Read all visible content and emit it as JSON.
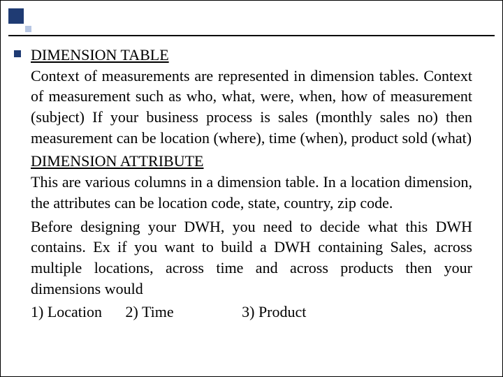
{
  "headings": {
    "dimension_table": "DIMENSION TABLE",
    "dimension_attribute": "DIMENSION ATTRIBUTE"
  },
  "paragraphs": {
    "p1": "Context of measurements are represented in dimension tables. Context of measurement such as who, what, were, when, how of measurement (subject) If your business process is sales (monthly sales no) then measurement can be location (where), time (when), product sold (what)",
    "p2": "This are various columns in a dimension table. In a location dimension, the attributes can be location code, state, country, zip code.",
    "p3": "Before designing your DWH, you need to decide what this DWH contains. Ex if you want to build a DWH containing Sales, across multiple locations, across time and across products then your dimensions would"
  },
  "dimensions_list": {
    "item1": "1) Location",
    "item2": "2) Time",
    "item3": "3) Product"
  }
}
